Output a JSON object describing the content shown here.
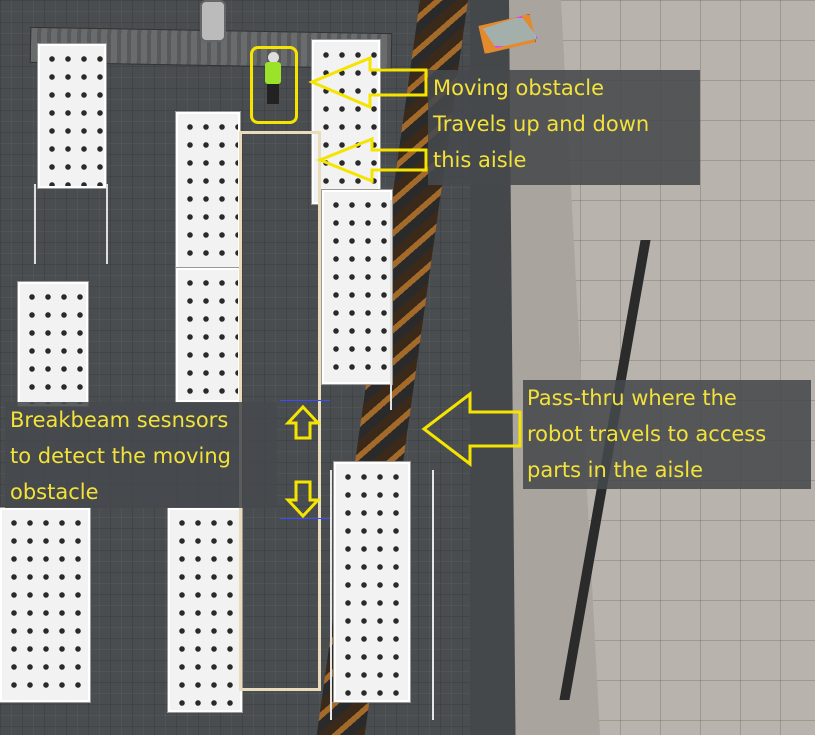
{
  "annotations": {
    "moving_obstacle": [
      "Moving obstacle",
      "Travels up and down",
      "this aisle"
    ],
    "pass_thru": [
      "Pass-thru where the",
      "robot travels to access",
      "parts in the aisle"
    ],
    "breakbeam": [
      "Breakbeam sesnsors",
      "to detect the moving",
      "obstacle"
    ]
  },
  "colors": {
    "annotation_text": "#f3e23a",
    "annotation_arrow": "#f5e400",
    "aisle_outline": "#e8dcbc",
    "beam": "#3c4cff",
    "worker_vest": "#9be22a",
    "agv": "#e38a2e"
  }
}
